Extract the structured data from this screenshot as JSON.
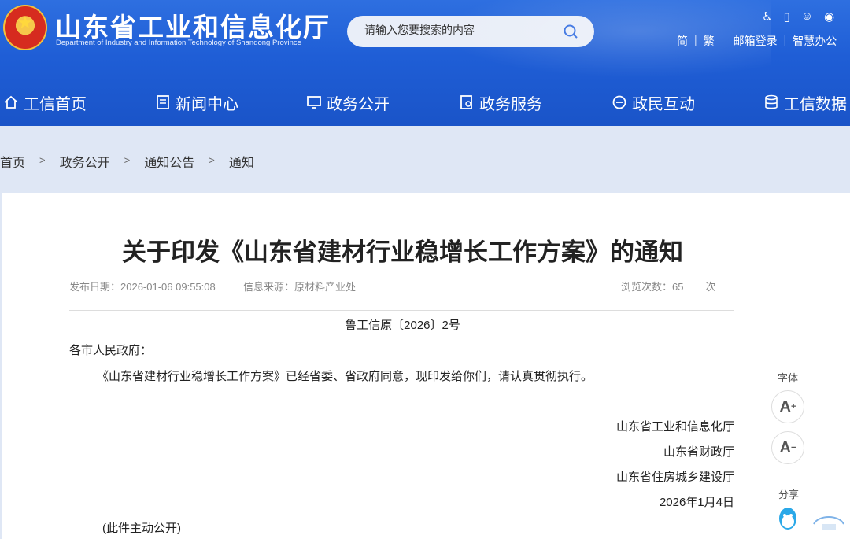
{
  "header": {
    "site_title": "山东省工业和信息化厅",
    "site_subtitle": "Department of Industry and Information Technology of Shandong Province",
    "search_placeholder": "请输入您要搜索的内容",
    "top_icons": [
      "accessibility-icon",
      "mobile-icon",
      "wechat-icon",
      "weibo-icon"
    ],
    "links": [
      "简",
      "繁",
      "邮箱登录",
      "智慧办公"
    ]
  },
  "nav": {
    "items": [
      {
        "label": "工信首页",
        "icon": "home-icon"
      },
      {
        "label": "新闻中心",
        "icon": "news-icon"
      },
      {
        "label": "政务公开",
        "icon": "monitor-icon"
      },
      {
        "label": "政务服务",
        "icon": "service-icon"
      },
      {
        "label": "政民互动",
        "icon": "chat-icon"
      },
      {
        "label": "工信数据",
        "icon": "database-icon"
      }
    ]
  },
  "breadcrumb": {
    "items": [
      "首页",
      "政务公开",
      "通知公告",
      "通知"
    ],
    "separator": ">"
  },
  "article": {
    "title": "关于印发《山东省建材行业稳增长工作方案》的通知",
    "publish_label": "发布日期：",
    "publish_date": "2026-01-06 09:55:08",
    "source_label": "信息来源：",
    "source": "原材料产业处",
    "views_label": "浏览次数：",
    "views": "65",
    "views_unit": "次",
    "doc_number": "鲁工信原〔2026〕2号",
    "salutation": "各市人民政府：",
    "paragraph": "《山东省建材行业稳增长工作方案》已经省委、省政府同意，现印发给你们，请认真贯彻执行。",
    "signatures": [
      "山东省工业和信息化厅",
      "山东省财政厅",
      "山东省住房城乡建设厅"
    ],
    "date": "2026年1月4日",
    "note": "(此件主动公开)"
  },
  "tools": {
    "font_label": "字体",
    "font_increase": "A",
    "font_decrease": "A",
    "share_label": "分享"
  },
  "colors": {
    "header_blue": "#1f5ed6",
    "page_bg": "#dfe7f5"
  }
}
